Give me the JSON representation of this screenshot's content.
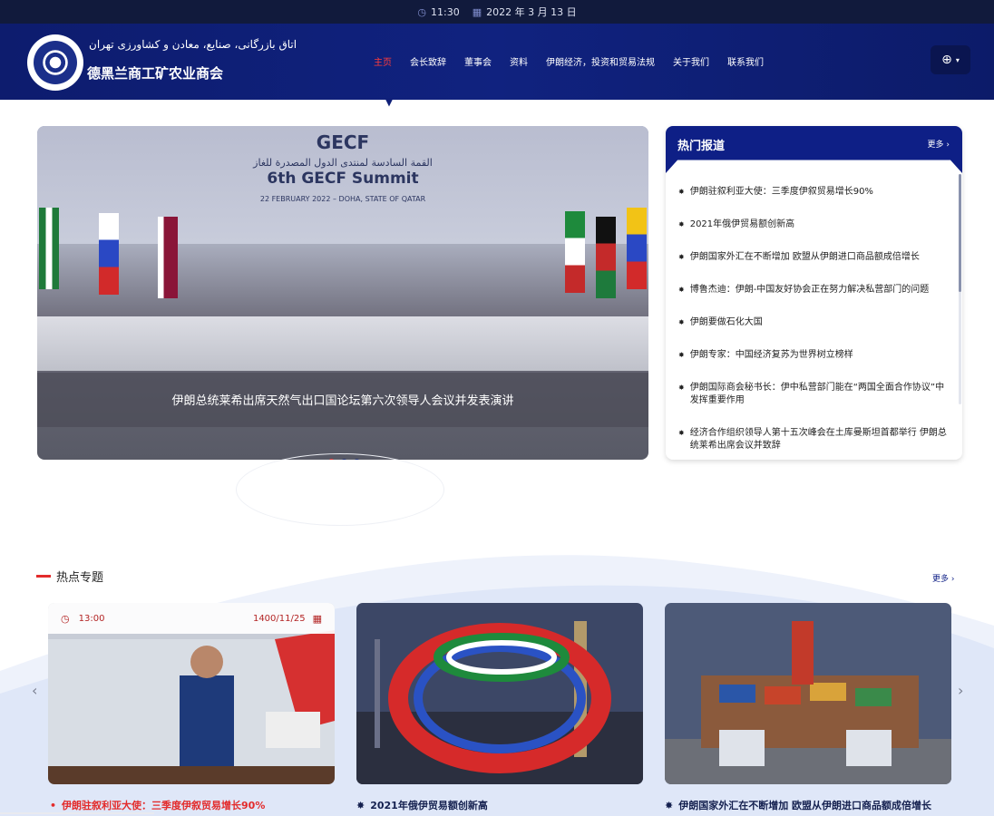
{
  "topbar": {
    "time": "11:30",
    "date": "2022 年 3 月 13 日",
    "clock_icon": "clock-icon",
    "calendar_icon": "calendar-icon"
  },
  "header": {
    "brand_fa": "اتاق بازرگانی، صنایع، معادن و کشاورزی تهران",
    "brand_zh": "德黑兰商工矿农业商会",
    "nav": [
      "主页",
      "会长致辞",
      "董事会",
      "资料",
      "伊朗经济，投资和贸易法规",
      "关于我们",
      "联系我们"
    ],
    "language_icon": "globe-icon"
  },
  "slider": {
    "banner_title": "GECF",
    "banner_arabic": "القمة السادسة لمنتدى الدول المصدرة للغاز",
    "banner_summit": "6th GECF Summit",
    "banner_date": "22 FEBRUARY 2022 – DOHA, STATE OF QATAR",
    "caption": "伊朗总统莱希出席天然气出口国论坛第六次领导人会议并发表演讲",
    "active_dot": 0,
    "dot_count": 3
  },
  "hot_news": {
    "title": "热门报道",
    "more": "更多 ›",
    "items": [
      "伊朗驻叙利亚大使：三季度伊叙贸易增长90%",
      "2021年俄伊贸易额创新高",
      "伊朗国家外汇在不断增加 欧盟从伊朗进口商品额成倍增长",
      "博鲁杰迪：伊朗-中国友好协会正在努力解决私营部门的问题",
      "伊朗要做石化大国",
      "伊朗专家：中国经济复苏为世界树立榜样",
      "伊朗国际商会秘书长：伊中私营部门能在“两国全面合作协议”中发挥重要作用",
      "经济合作组织领导人第十五次峰会在土库曼斯坦首都举行 伊朗总统莱希出席会议并致辞"
    ]
  },
  "topics": {
    "title": "热点专题",
    "more": "更多 ›",
    "cards": [
      {
        "time": "13:00",
        "date": "1400/11/25",
        "title": "伊朗驻叙利亚大使：三季度伊叙贸易增长90%"
      },
      {
        "time": "",
        "date": "",
        "title": "2021年俄伊贸易额创新高"
      },
      {
        "time": "",
        "date": "",
        "title": "伊朗国家外汇在不断增加 欧盟从伊朗进口商品额成倍增长"
      }
    ]
  },
  "colors": {
    "header": "#10227f",
    "accent_red": "#e32b2b",
    "navy": "#0e1f86"
  }
}
